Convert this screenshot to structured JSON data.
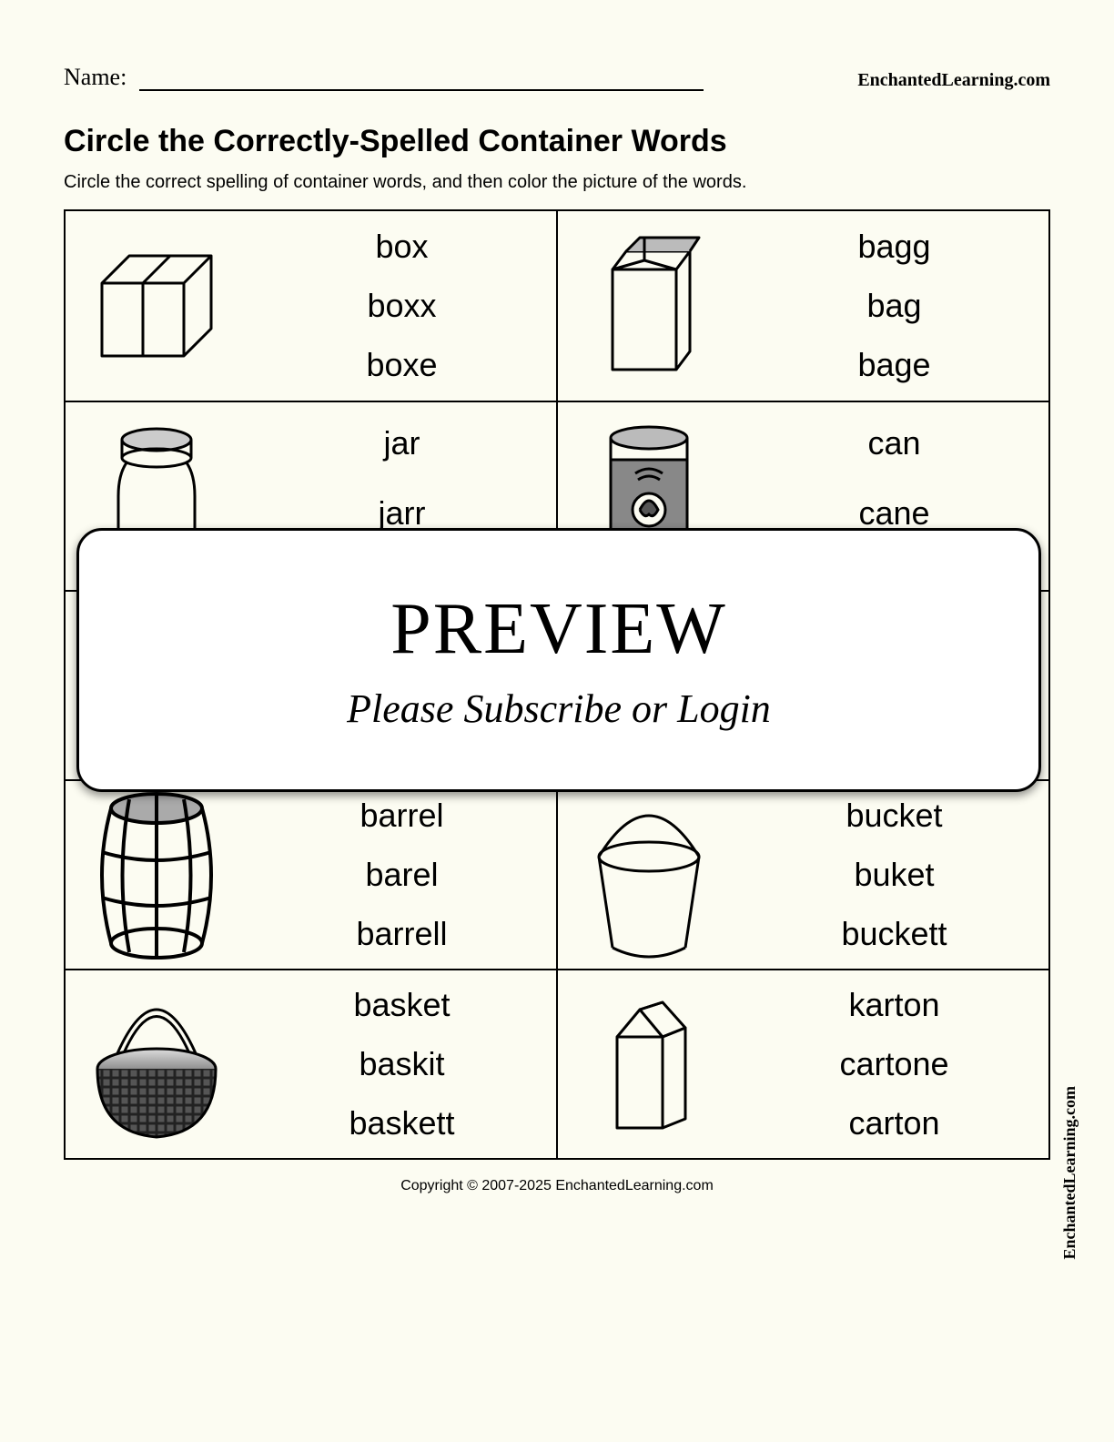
{
  "header": {
    "name_label": "Name:",
    "site": "EnchantedLearning.com"
  },
  "title": "Circle the Correctly-Spelled Container Words",
  "subtitle": "Circle the correct spelling of container words, and then color the picture of the words.",
  "cells": [
    {
      "icon": "box",
      "options": [
        "box",
        "boxx",
        "boxe"
      ]
    },
    {
      "icon": "bag",
      "options": [
        "bagg",
        "bag",
        "bage"
      ]
    },
    {
      "icon": "jar",
      "options": [
        "jar",
        "jarr",
        ""
      ]
    },
    {
      "icon": "can",
      "options": [
        "can",
        "cane",
        ""
      ]
    },
    {
      "icon": "",
      "options": [
        "",
        "",
        ""
      ]
    },
    {
      "icon": "",
      "options": [
        "",
        "",
        ""
      ]
    },
    {
      "icon": "barrel",
      "options": [
        "barrel",
        "barel",
        "barrell"
      ]
    },
    {
      "icon": "bucket",
      "options": [
        "bucket",
        "buket",
        "buckett"
      ]
    },
    {
      "icon": "basket",
      "options": [
        "basket",
        "baskit",
        "baskett"
      ]
    },
    {
      "icon": "carton",
      "options": [
        "karton",
        "cartone",
        "carton"
      ]
    }
  ],
  "overlay": {
    "big": "PREVIEW",
    "small": "Please Subscribe or Login"
  },
  "footer": "Copyright © 2007-2025 EnchantedLearning.com",
  "side_brand": "EnchantedLearning.com"
}
